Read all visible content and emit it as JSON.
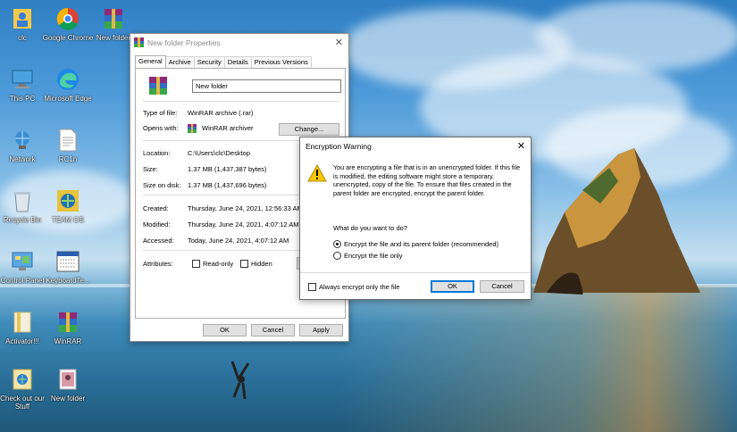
{
  "desktop": {
    "icons": [
      {
        "label": "clc"
      },
      {
        "label": "Google Chrome"
      },
      {
        "label": "New folder"
      },
      {
        "label": "This PC"
      },
      {
        "label": "Microsoft Edge"
      },
      {
        "label": "Network"
      },
      {
        "label": "RC1n"
      },
      {
        "label": "Recycle Bin"
      },
      {
        "label": "TEAM OS"
      },
      {
        "label": "Control Panel"
      },
      {
        "label": "KeyboardTe..."
      },
      {
        "label": "Activator!!!"
      },
      {
        "label": "WinRAR"
      },
      {
        "label": "Check out our Stuff"
      },
      {
        "label": "New folder"
      }
    ]
  },
  "properties": {
    "title": "New folder Properties",
    "tabs": [
      "General",
      "Archive",
      "Security",
      "Details",
      "Previous Versions"
    ],
    "name_value": "New folder",
    "type_label": "Type of file:",
    "type_value": "WinRAR archive (.rar)",
    "opens_label": "Opens with:",
    "opens_value": "WinRAR archiver",
    "change_label": "Change...",
    "location_label": "Location:",
    "location_value": "C:\\Users\\clc\\Desktop",
    "size_label": "Size:",
    "size_value": "1.37 MB (1,437,387 bytes)",
    "sizeondisk_label": "Size on disk:",
    "sizeondisk_value": "1.37 MB (1,437,696 bytes)",
    "created_label": "Created:",
    "created_value": "Thursday, June 24, 2021, 12:56:33 AM",
    "modified_label": "Modified:",
    "modified_value": "Thursday, June 24, 2021, 4:07:12 AM",
    "accessed_label": "Accessed:",
    "accessed_value": "Today, June 24, 2021, 4:07:12 AM",
    "attributes_label": "Attributes:",
    "readonly_label": "Read-only",
    "hidden_label": "Hidden",
    "advanced_label": "A",
    "ok_label": "OK",
    "cancel_label": "Cancel",
    "apply_label": "Apply"
  },
  "warning": {
    "title": "Encryption Warning",
    "message": "You are encrypting a file that is in an unencrypted folder. If this file is modified, the editing software might store a temporary, unencrypted, copy of the file. To ensure that files created in the parent folder are encrypted, encrypt the parent folder.",
    "question": "What do you want to do?",
    "option1": "Encrypt the file and its parent folder (recommended)",
    "option2": "Encrypt the file only",
    "always_label": "Always encrypt only the file",
    "ok_label": "OK",
    "cancel_label": "Cancel"
  }
}
